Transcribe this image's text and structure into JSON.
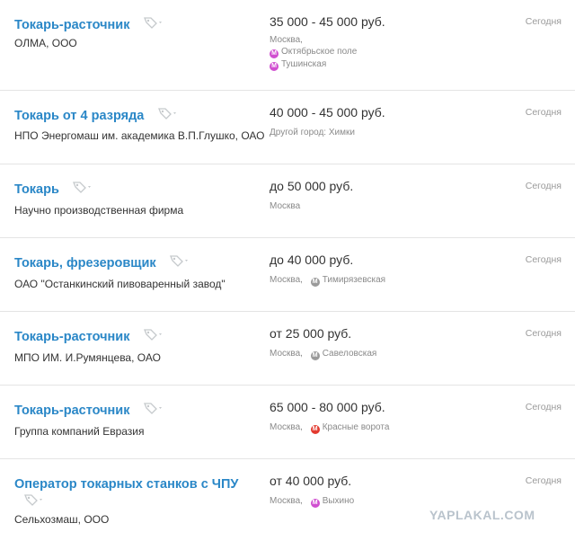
{
  "vacancies": [
    {
      "title": "Токарь-расточник",
      "company": "ОЛМА, ООО",
      "salary": "35 000 - 45 000 руб.",
      "city": "Москва,",
      "metro": [
        {
          "name": "Октябрьское поле",
          "color": "#d04fd0"
        },
        {
          "name": "Тушинская",
          "color": "#d04fd0"
        }
      ],
      "date": "Сегодня"
    },
    {
      "title": "Токарь от 4 разряда",
      "company": "НПО Энергомаш им. академика В.П.Глушко, ОАО",
      "salary": "40 000 - 45 000 руб.",
      "city": "Другой город: Химки",
      "metro": [],
      "date": "Сегодня"
    },
    {
      "title": "Токарь",
      "company": "Научно производственная фирма",
      "salary": "до 50 000 руб.",
      "city": "Москва",
      "metro": [],
      "date": "Сегодня"
    },
    {
      "title": "Токарь, фрезеровщик",
      "company": "ОАО \"Останкинский пивоваренный завод\"",
      "salary": "до 40 000 руб.",
      "city": "Москва,",
      "metro": [
        {
          "name": "Тимирязевская",
          "color": "#9a9a9a"
        }
      ],
      "date": "Сегодня"
    },
    {
      "title": "Токарь-расточник",
      "company": "МПО ИМ. И.Румянцева, ОАО",
      "salary": "от 25 000 руб.",
      "city": "Москва,",
      "metro": [
        {
          "name": "Савеловская",
          "color": "#9a9a9a"
        }
      ],
      "date": "Сегодня"
    },
    {
      "title": "Токарь-расточник",
      "company": "Группа компаний Евразия",
      "salary": "65 000 - 80 000 руб.",
      "city": "Москва,",
      "metro": [
        {
          "name": "Красные ворота",
          "color": "#e33a2f"
        }
      ],
      "date": "Сегодня"
    },
    {
      "title": "Оператор токарных станков с ЧПУ",
      "company": "Сельхозмаш, ООО",
      "salary": "от 40 000 руб.",
      "city": "Москва,",
      "metro": [
        {
          "name": "Выхино",
          "color": "#d04fd0"
        }
      ],
      "date": "Сегодня"
    }
  ],
  "metro_icon_letter": "М",
  "watermark": "YAPLAKAL.COM"
}
